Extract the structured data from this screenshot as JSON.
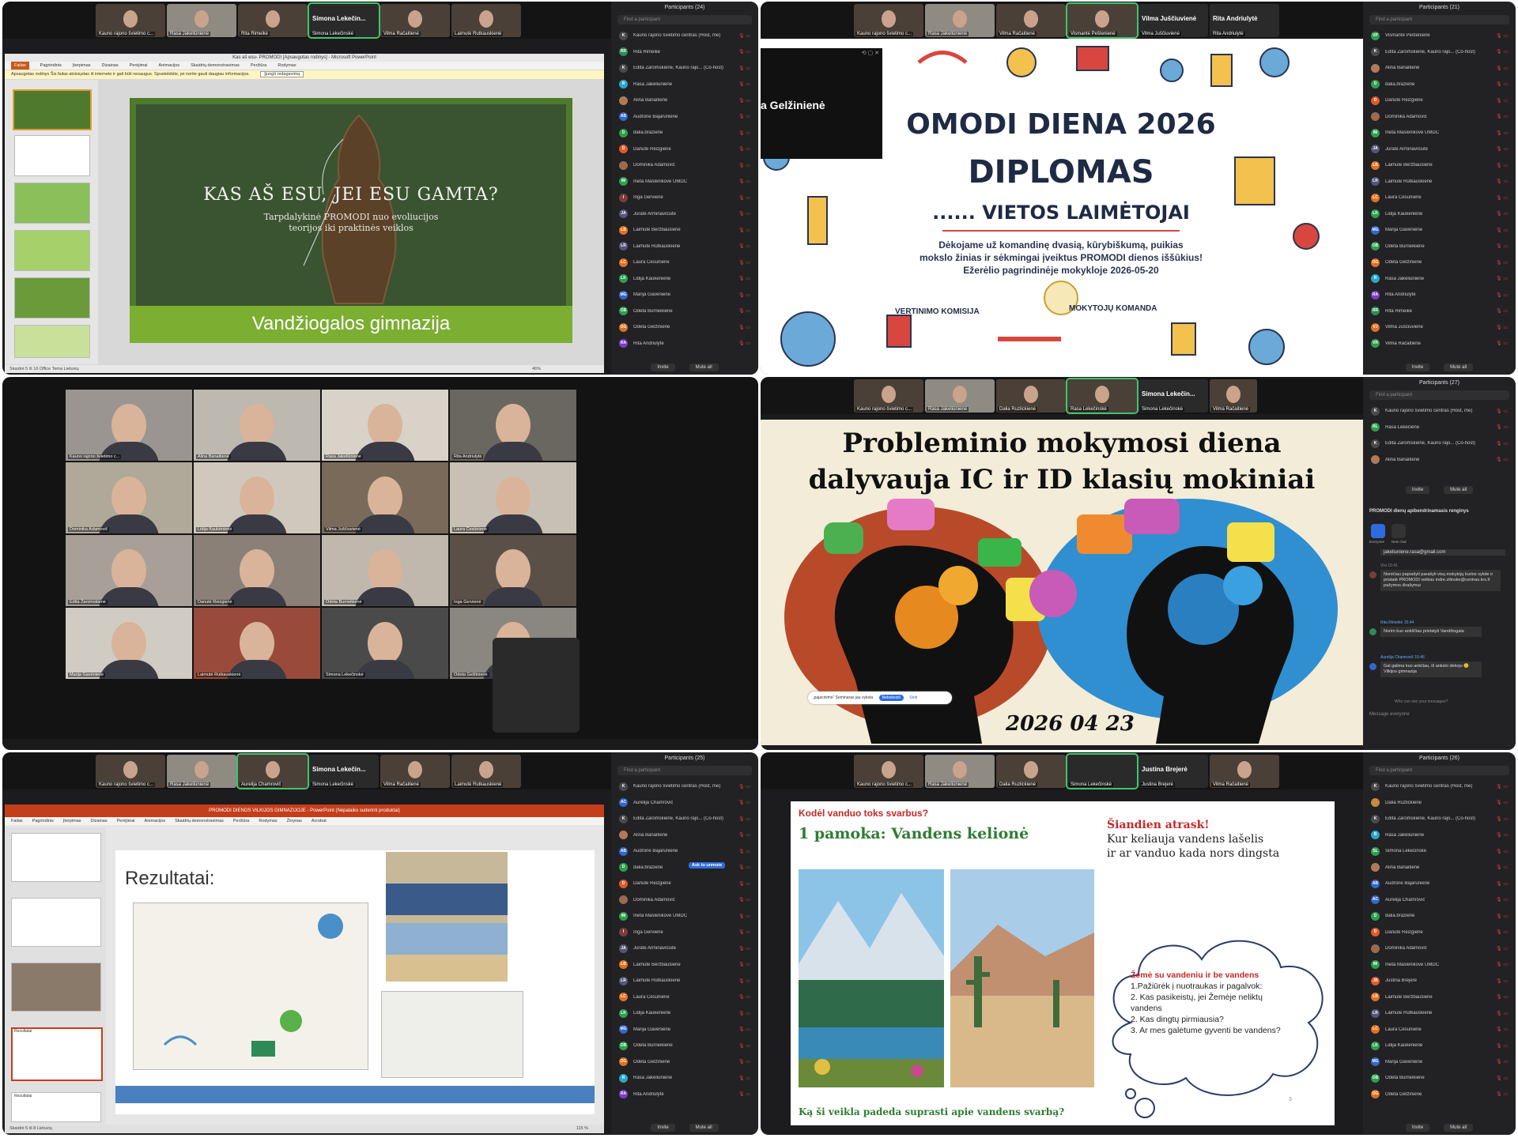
{
  "panels": {
    "p1": {
      "thumbs": [
        "Kauno rajono švietimo c...",
        "Rasa Jakeliūnienė",
        "Rita Rimeikė",
        "Simona Lekečinskė",
        "Vilma Račaitienė",
        "Laimutė Rutkauskienė"
      ],
      "speaker": "Simona Lekečin...",
      "ppt_title": "Kas aš esu- PROMODI [Apsaugotas rodinys] - Microsoft PowerPoint",
      "ppt_tabs": [
        "Failas",
        "Pagrindinis",
        "Įterpimas",
        "Dizainas",
        "Perėjimai",
        "Animacijos",
        "Skaidrių demonstravimas",
        "Peržiūra",
        "Rodymas"
      ],
      "warning": "Apsaugotas rodinys  Šis failas atsisiųstas iš interneto ir gali būti nesaugus. Spustelėkite, jei norite gauti daugiau informacijos.",
      "warning_button": "Įjungti redagavimą",
      "slide_title": "KAS AŠ ESU, JEI ESU GAMTA?",
      "slide_subtitle1": "Tarpdalykinė PROMODI          nuo evoliucijos",
      "slide_subtitle2": "teorijos iki praktinės veiklos",
      "slide_footer": "Vandžiogalos gimnazija",
      "status_left": "Skaidrė 5 iš 16   Office Tema   Lietuvių",
      "status_zoom": "46%",
      "participants_title": "Participants (24)",
      "find": "Find a participant",
      "participants": [
        {
          "name": "Kauno rajono švietimo centras (Host, me)",
          "initials": "K",
          "color": "#4a4a4a"
        },
        {
          "name": "Rita Rimeikė",
          "initials": "RR",
          "color": "#2e8b57"
        },
        {
          "name": "Edita Žaromskienė, Kauno rajo... (Co-host)",
          "initials": "K",
          "color": "#4a4a4a"
        },
        {
          "name": "Rasa Jakeliūnienė",
          "initials": "R",
          "color": "#2aa7c9"
        },
        {
          "name": "Alina Banaitienė",
          "initials": "",
          "color": "#b07a5a"
        },
        {
          "name": "Audronė Bajarūnienė",
          "initials": "AB",
          "color": "#3366cc"
        },
        {
          "name": "dalia.braziene",
          "initials": "D",
          "color": "#2e9e4f"
        },
        {
          "name": "Danutė Reizgienė",
          "initials": "D",
          "color": "#e05a2a"
        },
        {
          "name": "Dominika Adamovič",
          "initials": "",
          "color": "#9a6b4f"
        },
        {
          "name": "Ineta Maslenikovė UMDC",
          "initials": "IM",
          "color": "#2e9e4f"
        },
        {
          "name": "Inga Gervienė",
          "initials": "I",
          "color": "#7a3d3d"
        },
        {
          "name": "Jurate Arminavičiūtė",
          "initials": "JA",
          "color": "#555577"
        },
        {
          "name": "Laimutė Beržbaušienė",
          "initials": "LB",
          "color": "#e07020"
        },
        {
          "name": "Laimutė Rutkauskienė",
          "initials": "LR",
          "color": "#555577"
        },
        {
          "name": "Laura Česūnienė",
          "initials": "LC",
          "color": "#e07020"
        },
        {
          "name": "Lidija Kaukėnienė",
          "initials": "LK",
          "color": "#2e9e4f"
        },
        {
          "name": "Marija Gavėnienė",
          "initials": "MG",
          "color": "#3366cc"
        },
        {
          "name": "Odeta Burneikienė",
          "initials": "OB",
          "color": "#2e9e4f"
        },
        {
          "name": "Odeta Gelžinienė",
          "initials": "OG",
          "color": "#e07020"
        },
        {
          "name": "Rita Andriulytė",
          "initials": "RA",
          "color": "#7a3dc9"
        }
      ],
      "btn_invite": "Invite",
      "btn_mute": "Mute all"
    },
    "p2": {
      "thumbs": [
        "Kauno rajono švietimo c...",
        "Rasa Jakeliūnienė",
        "Vilma Račaitienė",
        "Vismantė Peštenienė",
        "Vilma Juščiuvienė",
        "Rita Andriulytė"
      ],
      "speaker_a": "Vilma Juščiuvienė",
      "speaker_b": "Rita Andriulytė",
      "floating_name": "a Gelžinienė",
      "title1": "OMODI DIENA 2026",
      "title2": "DIPLOMAS",
      "title3": "...... VIETOS LAIMĖTOJAI",
      "body1": "Dėkojame už komandinę dvasią, kūrybiškumą, puikias",
      "body2": "mokslo žinias ir sėkmingai įveiktus PROMODI dienos iššūkius!",
      "body3": "Ežerėlio pagrindinėje mokykloje 2026-05-20",
      "left_sign": "VERTINIMO KOMISIJA",
      "right_sign": "MOKYTOJŲ KOMANDA",
      "participants_title": "Participants (21)",
      "find": "Find a participant",
      "participants": [
        {
          "name": "Vismantė Peštenienė",
          "initials": "VP",
          "color": "#2e9e4f"
        },
        {
          "name": "Edita Žaromskienė, Kauno rajo... (Co-host)",
          "initials": "K",
          "color": "#4a4a4a"
        },
        {
          "name": "Alina Banaitienė",
          "initials": "",
          "color": "#b07a5a"
        },
        {
          "name": "dalia.braziene",
          "initials": "D",
          "color": "#2e9e4f"
        },
        {
          "name": "Danutė Reizgienė",
          "initials": "D",
          "color": "#e05a2a"
        },
        {
          "name": "Dominika Adamovič",
          "initials": "",
          "color": "#9a6b4f"
        },
        {
          "name": "Ineta Maslenikovė UMDC",
          "initials": "IM",
          "color": "#2e9e4f"
        },
        {
          "name": "Jurate Arminavičiūtė",
          "initials": "JA",
          "color": "#555577"
        },
        {
          "name": "Laimutė Beržbaušienė",
          "initials": "LB",
          "color": "#e07020"
        },
        {
          "name": "Laimutė Rutkauskienė",
          "initials": "LR",
          "color": "#555577"
        },
        {
          "name": "Laura Česūnienė",
          "initials": "LC",
          "color": "#e07020"
        },
        {
          "name": "Lidija Kaukėnienė",
          "initials": "LK",
          "color": "#2e9e4f"
        },
        {
          "name": "Marija Gavėnienė",
          "initials": "MG",
          "color": "#3366cc"
        },
        {
          "name": "Odeta Burneikienė",
          "initials": "OB",
          "color": "#2e9e4f"
        },
        {
          "name": "Odeta Gelžinienė",
          "initials": "OG",
          "color": "#e07020"
        },
        {
          "name": "Rasa Jakeliūnienė",
          "initials": "R",
          "color": "#2aa7c9"
        },
        {
          "name": "Rita Andriulytė",
          "initials": "RA",
          "color": "#7a3dc9"
        },
        {
          "name": "Rita Rimeikė",
          "initials": "RR",
          "color": "#2e8b57"
        },
        {
          "name": "Vilma Juščiuvienė",
          "initials": "VJ",
          "color": "#e07020"
        },
        {
          "name": "Vilma Račaitienė",
          "initials": "VR",
          "color": "#2e9e4f"
        }
      ],
      "btn_invite": "Invite",
      "btn_mute": "Mute all"
    },
    "p3": {
      "tiles": [
        "Kauno rajono švietimo c...",
        "Alina Banaitienė",
        "Rasa Jakeliūnienė",
        "Rita Andriulytė",
        "Dominika Adamovič",
        "Lidija Kaukėnienė",
        "Vilma Juščiuvienė",
        "Laura Česūnienė",
        "Edita Žaromskienė",
        "Danutė Reizgienė",
        "Odeta Burneikienė",
        "Inga Gervienė",
        "Marija Gavėnienė",
        "Laimutė Rutkauskienė",
        "Simona Lekečinskė",
        "Odeta Gelžinienė"
      ]
    },
    "p4": {
      "thumbs": [
        "Kauno rajono švietimo c...",
        "Rasa Jakeliūnienė",
        "Dalia Ruzlickienė",
        "Rasa Lekečinskė",
        "Simona Lekečinskė",
        "Vilma Račaitienė"
      ],
      "speaker": "Simona Lekečin...",
      "title1": "Probleminio mokymosi diena",
      "title2": "dalyvauja IC ir ID klasių mokiniai",
      "date": "2026 04 23",
      "notice": "„pajacinimo“ Seminaras jau vyksta",
      "notice_btn": "Nebekeisti",
      "notice_link": "Stoti",
      "participants_title": "Participants (27)",
      "find": "Find a participant",
      "participants": [
        {
          "name": "Kauno rajono švietimo centras (Host, me)",
          "initials": "K",
          "color": "#4a4a4a"
        },
        {
          "name": "Rasa Lekečienė",
          "initials": "RL",
          "color": "#2e9e4f"
        },
        {
          "name": "Edita Žaromskienė, Kauno rajo... (Co-host)",
          "initials": "K",
          "color": "#4a4a4a"
        },
        {
          "name": "Alina Banaitienė",
          "initials": "",
          "color": "#b07a5a"
        }
      ],
      "btn_invite": "Invite",
      "btn_mute": "Mute all",
      "chat_title": "PROMODI dienų apibendrinamasis renginys",
      "chat_tabs": [
        "Everyone",
        "New chat"
      ],
      "chat_email": "jakeliuniene.rasa@gmail.com",
      "chat_time1": "Visi 15:41",
      "chat_msg1": "Norėčiau paprašyti parašyti visų mokytojų kurios vykde ir pristatė PROMODI veiklas indre.zilinske@centras.krs.lt pažymos išrašymui",
      "chat_sender2": "Rita Rimeikė 15:44",
      "chat_msg2": "Norim kuo ankščiau pristatyti Vandžiogala",
      "chat_sender3": "Aurelija Chamrovič 15:46",
      "chat_msg3": "Gal galima kuo ankčiau, iš anksto dėkoju 😊 Vilkijos gimnazija",
      "chat_hint": "Who can see your messages?",
      "chat_input": "Message everyone"
    },
    "p5": {
      "thumbs": [
        "Kauno rajono švietimo c...",
        "Rasa Jakeliūnienė",
        "Aurelija Chamrovič",
        "Simona Lekečinskė",
        "Vilma Račaitienė",
        "Laimutė Rutkauskienė"
      ],
      "speaker": "Simona Lekečin...",
      "ppt_title": "PROMODI DIENOS VILKIJOS GIMNAZIJOJE - PowerPoint (Nėpalaiko suderinti produktai)",
      "ppt_tabs": [
        "Failas",
        "Pagrindinis",
        "Įterpimas",
        "Dizainas",
        "Perėjimai",
        "Animacijos",
        "Skaidrių demonstravimas",
        "Peržiūra",
        "Rodymas",
        "Žinynas",
        "Acrobat"
      ],
      "slide_title": "Rezultatai:",
      "thumb_label1": "Rezultatai",
      "thumb_label2": "Rezultatai",
      "status_left": "Skaidrė 5 iš 8   Lietuvių",
      "status_zoom": "115 %",
      "participants_title": "Participants (25)",
      "find": "Find a participant",
      "ask_unmute": "Ask to unmute",
      "participants": [
        {
          "name": "Kauno rajono švietimo centras (Host, me)",
          "initials": "K",
          "color": "#4a4a4a"
        },
        {
          "name": "Aurelija Chamrovič",
          "initials": "AC",
          "color": "#3366cc"
        },
        {
          "name": "Edita Žaromskienė, Kauno rajo... (Co-host)",
          "initials": "K",
          "color": "#4a4a4a"
        },
        {
          "name": "Alina Banaitienė",
          "initials": "",
          "color": "#b07a5a"
        },
        {
          "name": "Audronė Bajarūnienė",
          "initials": "AB",
          "color": "#3366cc"
        },
        {
          "name": "dalia.braziene",
          "initials": "D",
          "color": "#2e9e4f"
        },
        {
          "name": "Danutė Reizgienė",
          "initials": "D",
          "color": "#e05a2a"
        },
        {
          "name": "Dominika Adamovič",
          "initials": "",
          "color": "#9a6b4f"
        },
        {
          "name": "Ineta Maslenikovė UMDC",
          "initials": "IM",
          "color": "#2e9e4f"
        },
        {
          "name": "Inga Gervienė",
          "initials": "I",
          "color": "#7a3d3d"
        },
        {
          "name": "Jurate Arminavičiūtė",
          "initials": "JA",
          "color": "#555577"
        },
        {
          "name": "Laimutė Beržbaušienė",
          "initials": "LB",
          "color": "#e07020"
        },
        {
          "name": "Laimutė Rutkauskienė",
          "initials": "LR",
          "color": "#555577"
        },
        {
          "name": "Laura Česūnienė",
          "initials": "LC",
          "color": "#e07020"
        },
        {
          "name": "Lidija Kaukėnienė",
          "initials": "LK",
          "color": "#2e9e4f"
        },
        {
          "name": "Marija Gavėnienė",
          "initials": "MG",
          "color": "#3366cc"
        },
        {
          "name": "Odeta Burneikienė",
          "initials": "OB",
          "color": "#2e9e4f"
        },
        {
          "name": "Odeta Gelžinienė",
          "initials": "OG",
          "color": "#e07020"
        },
        {
          "name": "Rasa Jakeliūnienė",
          "initials": "R",
          "color": "#2aa7c9"
        },
        {
          "name": "Rita Andriulytė",
          "initials": "RA",
          "color": "#7a3dc9"
        }
      ],
      "btn_invite": "Invite",
      "btn_mute": "Mute all"
    },
    "p6": {
      "thumbs": [
        "Kauno rajono švietimo c...",
        "Rasa Jakeliūnienė",
        "Dalia Ruzlickienė",
        "Simona Lekečinskė",
        "Justina Brejerė",
        "Vilma Račaitienė"
      ],
      "speaker": "Justina Brejerė",
      "question_top": "Kodėl vanduo toks svarbus?",
      "lesson": "1 pamoka: Vandens kelionė",
      "discover_title": "Šiandien atrask!",
      "discover1": "Kur keliauja vandens lašelis",
      "discover2": "ir ar vanduo kada nors dingsta",
      "cloud_title": "Žemė su vandeniu ir be vandens",
      "cloud1": "1.Pažiūrėk į nuotraukas ir pagalvok:",
      "cloud2": "2. Kas pasikeistų, jei Žemėje neliktų",
      "cloud3": "vandens",
      "cloud4": "2. Kas dingtų pirmiausia?",
      "cloud5": "3. Ar mes galėtume gyventi be vandens?",
      "bottom_question": "Ką ši veikla padeda suprasti apie vandens svarbą?",
      "page_num": "3",
      "participants_title": "Participants (26)",
      "find": "Find a participant",
      "participants": [
        {
          "name": "Kauno rajono švietimo centras (Host, me)",
          "initials": "K",
          "color": "#4a4a4a"
        },
        {
          "name": "Dalia Ruzlickienė",
          "initials": "",
          "color": "#c98a3a"
        },
        {
          "name": "Edita Žaromskienė, Kauno rajo... (Co-host)",
          "initials": "K",
          "color": "#4a4a4a"
        },
        {
          "name": "Rasa Jakeliūnienė",
          "initials": "R",
          "color": "#2aa7c9"
        },
        {
          "name": "Simona Lekečinskė",
          "initials": "SL",
          "color": "#2e9e4f"
        },
        {
          "name": "Alina Banaitienė",
          "initials": "",
          "color": "#b07a5a"
        },
        {
          "name": "Audronė Bajarūnienė",
          "initials": "AB",
          "color": "#3366cc"
        },
        {
          "name": "Aurelija Chamrovič",
          "initials": "AC",
          "color": "#3366cc"
        },
        {
          "name": "dalia.braziene",
          "initials": "D",
          "color": "#2e9e4f"
        },
        {
          "name": "Danutė Reizgienė",
          "initials": "D",
          "color": "#e05a2a"
        },
        {
          "name": "Dominika Adamovič",
          "initials": "",
          "color": "#9a6b4f"
        },
        {
          "name": "Ineta Maslenikovė UMDC",
          "initials": "IM",
          "color": "#2e9e4f"
        },
        {
          "name": "Justina Brejerė",
          "initials": "JB",
          "color": "#e05a2a"
        },
        {
          "name": "Laimutė Beržbaušienė",
          "initials": "LB",
          "color": "#e07020"
        },
        {
          "name": "Laimutė Rutkauskienė",
          "initials": "LR",
          "color": "#555577"
        },
        {
          "name": "Laura Česūnienė",
          "initials": "LC",
          "color": "#e07020"
        },
        {
          "name": "Lidija Kaukėnienė",
          "initials": "LK",
          "color": "#2e9e4f"
        },
        {
          "name": "Marija Gavėnienė",
          "initials": "MG",
          "color": "#3366cc"
        },
        {
          "name": "Odeta Burneikienė",
          "initials": "OB",
          "color": "#2e9e4f"
        },
        {
          "name": "Odeta Gelžinienė",
          "initials": "OG",
          "color": "#e07020"
        }
      ],
      "btn_invite": "Invite",
      "btn_mute": "Mute all"
    }
  }
}
